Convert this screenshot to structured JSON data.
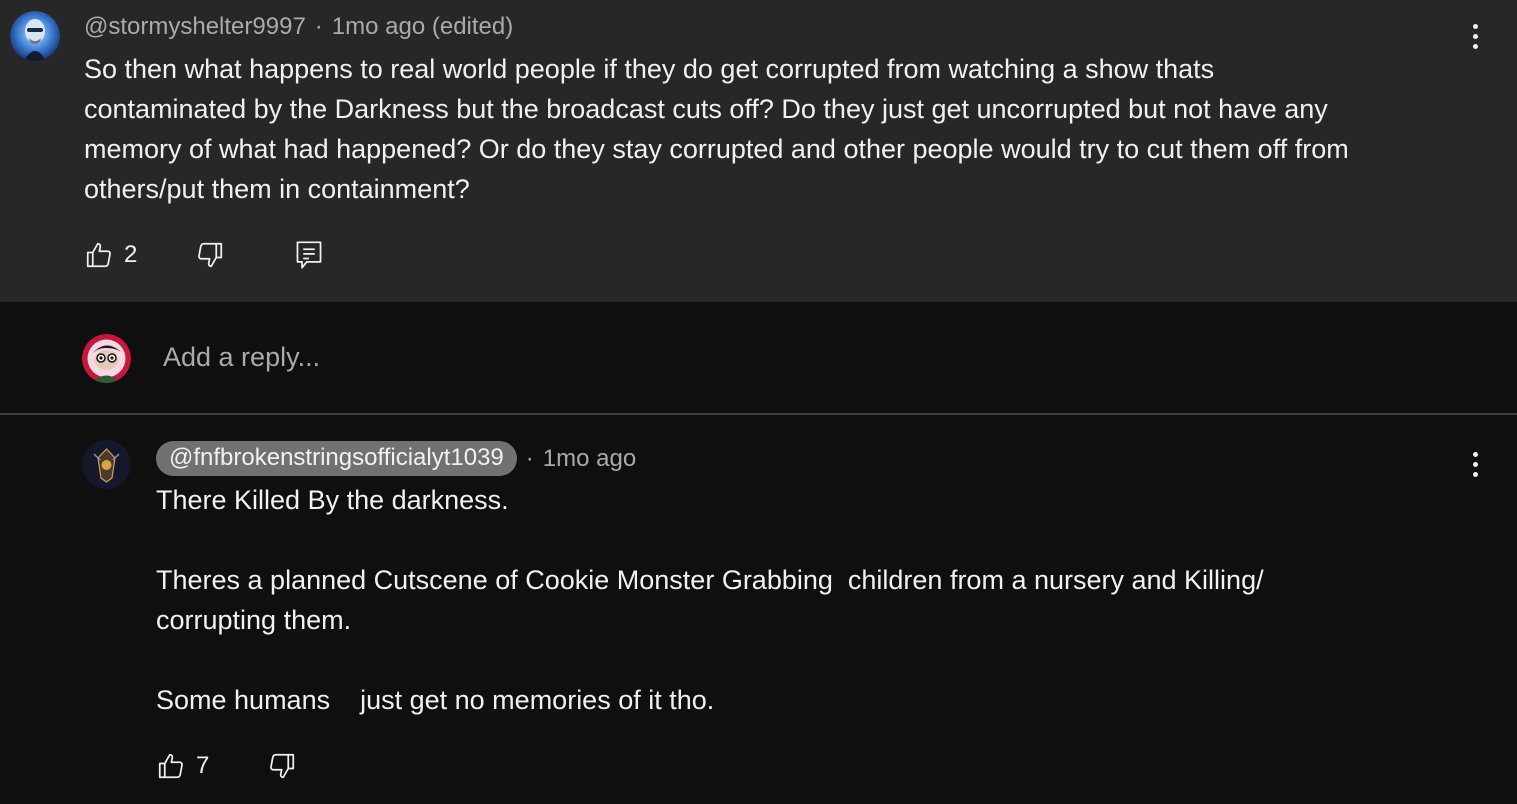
{
  "comment": {
    "author": "@stormyshelter9997",
    "separator": "·",
    "time": "1mo ago (edited)",
    "text_lines": [
      "So then what happens to real world people if they do get corrupted from watching a show thats",
      "contaminated by the Darkness but the broadcast cuts off? Do they just get uncorrupted but not have any",
      "memory of what had happened? Or do they stay corrupted and other people would try to cut them off from",
      "others/put them in containment?"
    ],
    "like_count": "2",
    "icons": {
      "like": "thumbs-up-icon",
      "dislike": "thumbs-down-icon",
      "reply": "comment-icon",
      "menu": "more-vert-icon"
    }
  },
  "reply_box": {
    "placeholder": "Add a reply..."
  },
  "reply": {
    "author": "@fnfbrokenstringsofficialyt1039",
    "separator": "·",
    "time": "1mo ago",
    "text_lines": [
      "There Killed By the darkness.",
      "",
      "Theres a planned Cutscene of Cookie Monster Grabbing  children from a nursery and Killing/",
      "corrupting them.",
      "",
      "Some humans    just get no memories of it tho."
    ],
    "like_count": "7"
  },
  "colors": {
    "highlight_bg": "#272727",
    "page_bg": "#0f0f0f",
    "text_primary": "#f1f1f1",
    "text_secondary": "#aaaaaa",
    "handle_chip_bg": "#717171"
  }
}
